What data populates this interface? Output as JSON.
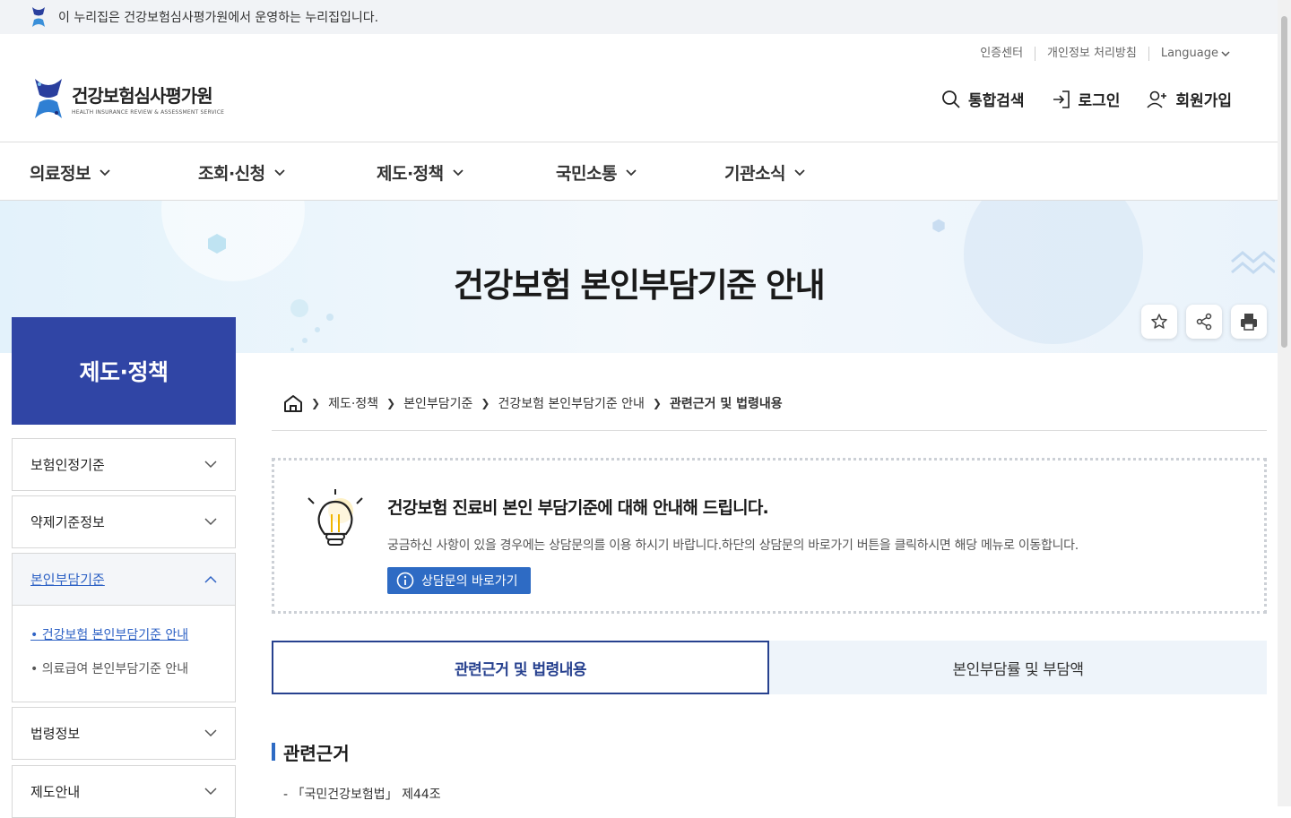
{
  "gov_banner": {
    "text": "이 누리집은 건강보험심사평가원에서 운영하는 누리집입니다."
  },
  "utility": {
    "cert": "인증센터",
    "privacy": "개인정보 처리방침",
    "language": "Language"
  },
  "logo": {
    "name_ko": "건강보험심사평가원",
    "name_en": "HEALTH INSURANCE REVIEW & ASSESSMENT SERVICE"
  },
  "header_actions": {
    "search": "통합검색",
    "login": "로그인",
    "join": "회원가입"
  },
  "gnb": [
    "의료정보",
    "조회·신청",
    "제도·정책",
    "국민소통",
    "기관소식"
  ],
  "hero": {
    "title": "건강보험 본인부담기준 안내"
  },
  "sidebar": {
    "heading": "제도·정책",
    "items": [
      "보험인정기준",
      "약제기준정보",
      "본인부담기준",
      "법령정보",
      "제도안내"
    ],
    "sub_items": [
      "• 건강보험 본인부담기준 안내",
      "• 의료급여 본인부담기준 안내"
    ]
  },
  "breadcrumb": [
    "제도·정책",
    "본인부담기준",
    "건강보험 본인부담기준 안내",
    "관련근거 및 법령내용"
  ],
  "notice": {
    "title": "건강보험 진료비 본인 부담기준에 대해 안내해 드립니다.",
    "desc": "궁금하신 사항이 있을 경우에는 상담문의를 이용 하시기 바랍니다.하단의 상담문의 바로가기 버튼을 클릭하시면 해당 메뉴로 이동합니다.",
    "button": "상담문의 바로가기"
  },
  "tabs": [
    "관련근거 및 법령내용",
    "본인부담률 및 부담액"
  ],
  "section": {
    "title": "관련근거",
    "law_line": "- 「국민건강보험법」 제44조"
  },
  "colors": {
    "primary": "#3045a5",
    "accent_blue": "#2e6bc4",
    "tab_border": "#27418f"
  }
}
